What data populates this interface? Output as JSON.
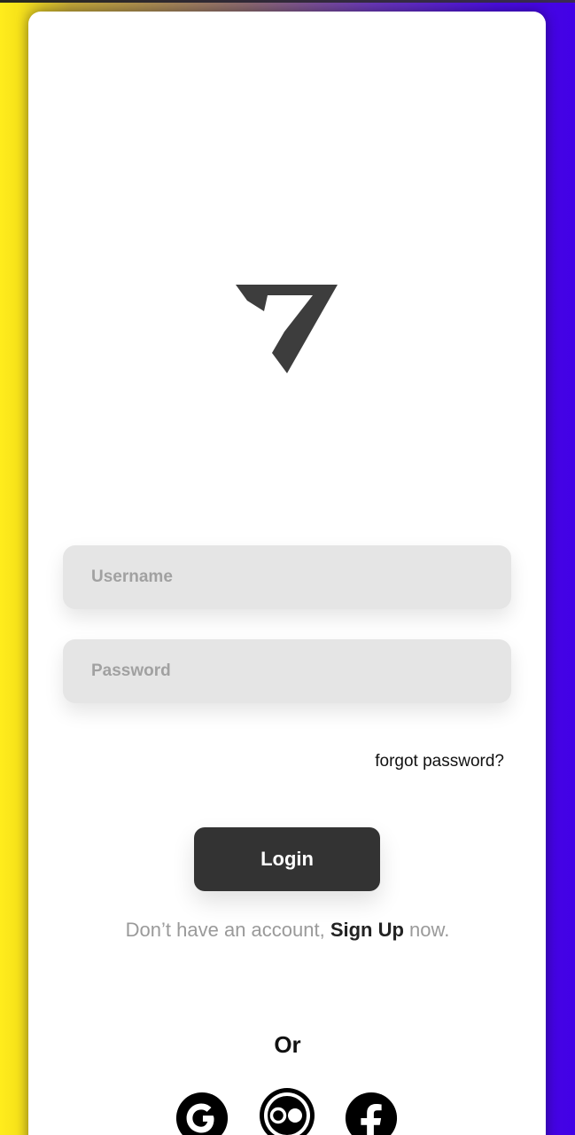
{
  "login_form": {
    "username_placeholder": "Username",
    "password_placeholder": "Password",
    "forgot_label": "forgot password?",
    "login_label": "Login",
    "signup_prefix": "Don’t have an account, ",
    "signup_link": "Sign Up",
    "signup_suffix": " now.",
    "or_label": "Or"
  },
  "social": [
    {
      "icon": "google-icon"
    },
    {
      "icon": "flickr-icon"
    },
    {
      "icon": "facebook-icon"
    }
  ],
  "colors": {
    "button": "#333333",
    "field": "#e5e5e5",
    "gradient_left": "#ffec1c",
    "gradient_right": "#4200e6"
  }
}
